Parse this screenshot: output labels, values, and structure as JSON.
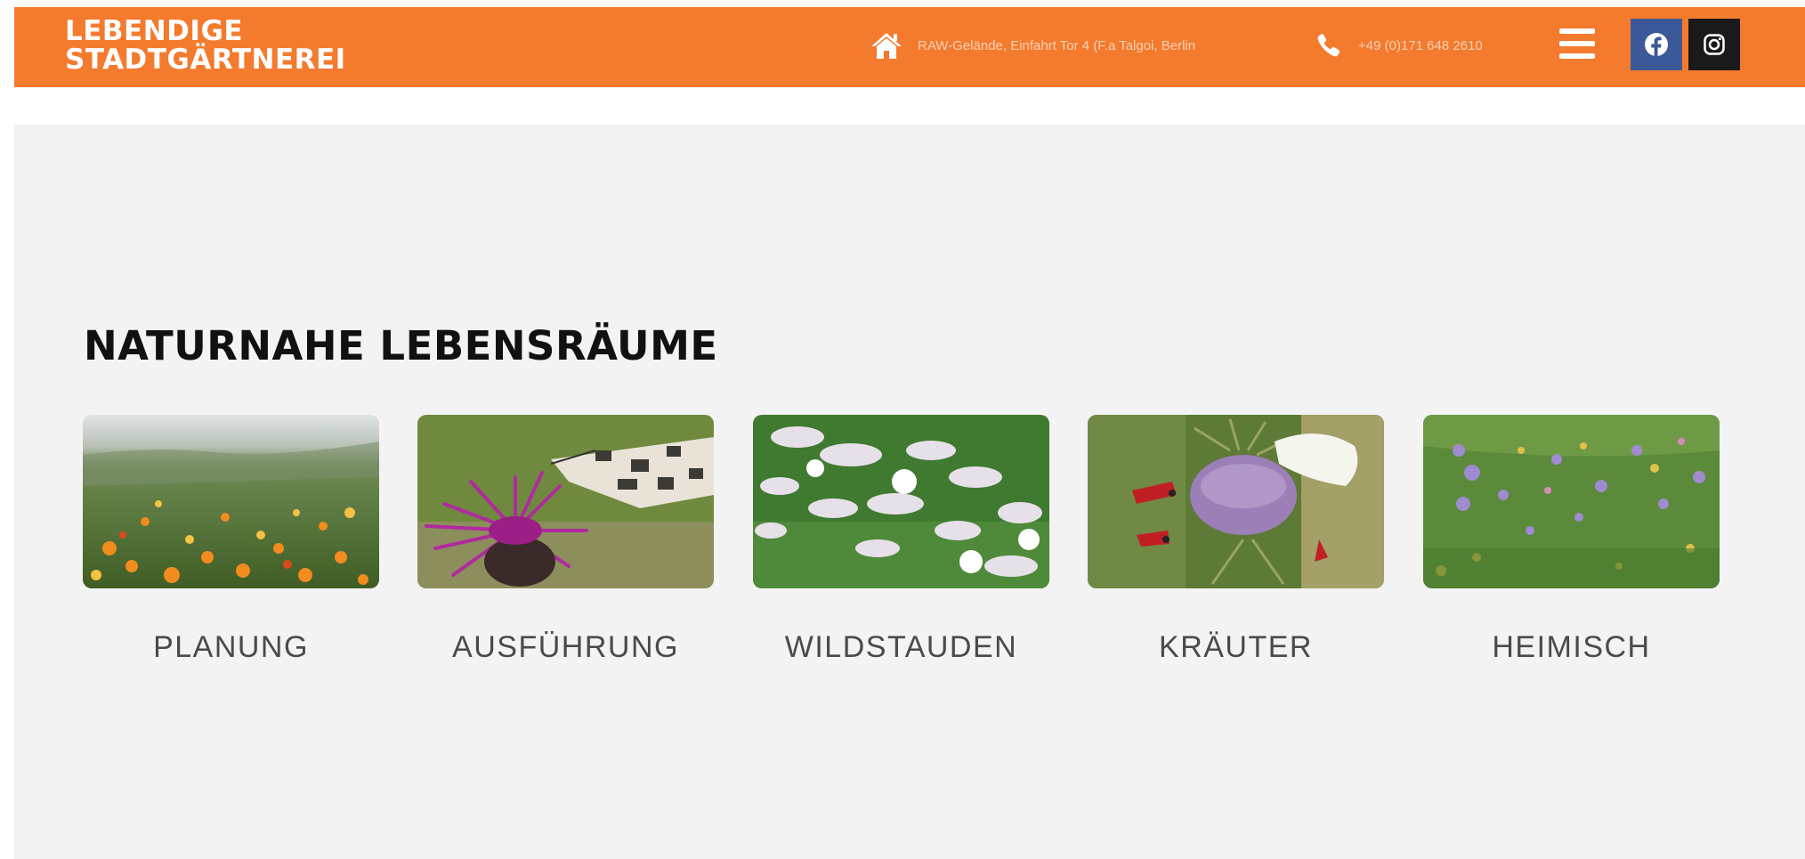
{
  "header": {
    "logo_line1": "LEBENDIGE",
    "logo_line2": "STADTGÄRTNEREI",
    "address": "RAW-Gelände, Einfahrt Tor 4 (F.a Talgoi, Berlin",
    "phone": "+49 (0)171 648 2610",
    "icons": [
      "home-icon",
      "phone-icon",
      "menu-icon",
      "facebook-icon",
      "instagram-icon"
    ]
  },
  "colors": {
    "header_bg": "#f47a2e",
    "section_bg": "#f3f3f3",
    "facebook": "#3b5998",
    "instagram": "#1a1a1a"
  },
  "main": {
    "title": "NATURNAHE LEBENSRÄUME",
    "cards": [
      {
        "label": "PLANUNG",
        "image": "flower-meadow-photo"
      },
      {
        "label": "AUSFÜHRUNG",
        "image": "butterfly-on-knapweed-photo"
      },
      {
        "label": "WILDSTAUDEN",
        "image": "white-campion-flowers-photo"
      },
      {
        "label": "KRÄUTER",
        "image": "teasel-with-moths-photo"
      },
      {
        "label": "HEIMISCH",
        "image": "wildflower-field-photo"
      }
    ]
  }
}
